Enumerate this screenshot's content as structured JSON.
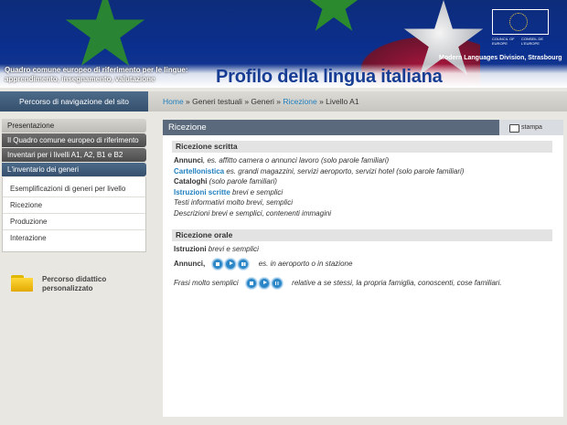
{
  "header": {
    "subtitle": "Quadro comune europeo di riferimento per le lingue: apprendimento, insegnamento, valutazione",
    "title": "Profilo della lingua italiana",
    "coe_left": "COUNCIL OF EUROPE",
    "coe_right": "CONSEIL DE L'EUROPE",
    "division": "Modern Languages Division, Strasbourg"
  },
  "nav": {
    "title": "Percorso di navigazione del sito",
    "breadcrumb": {
      "home": "Home",
      "sep": " » ",
      "c1": "Generi testuali",
      "c2": "Generi",
      "c3": "Ricezione",
      "c4": "Livello A1"
    }
  },
  "sidebar": {
    "items": [
      "Presentazione",
      "Il Quadro comune europeo di riferimento",
      "Inventari per i livelli A1, A2, B1 e B2",
      "L'inventario dei generi"
    ],
    "sub_items": [
      "Esemplificazioni di generi per livello",
      "Ricezione",
      "Produzione",
      "Interazione"
    ],
    "folder_label": "Percorso didattico personalizzato"
  },
  "main": {
    "title": "Ricezione",
    "print": "stampa",
    "scritta": {
      "heading": "Ricezione scritta",
      "rows": [
        {
          "bold": "Annunci",
          "rest": ", es. affitto camera o annunci lavoro (solo parole familiari)"
        },
        {
          "link": "Cartellonistica",
          "rest": " es. grandi magazzini, servizi aeroporto, servizi hotel (solo parole familiari)"
        },
        {
          "bold": "Cataloghi",
          "rest": " (solo parole familiari)"
        },
        {
          "link": "Istruzioni scritte",
          "rest": " brevi e semplici"
        },
        {
          "plain": "Testi informativi molto brevi, semplici"
        },
        {
          "plain": "Descrizioni brevi e semplici, contenenti immagini"
        }
      ]
    },
    "orale": {
      "heading": "Ricezione orale",
      "row1_bold": "Istruzioni",
      "row1_rest": " brevi e semplici",
      "row2_bold": "Annunci,",
      "row2_rest": "es. in aeroporto o in stazione",
      "row3_text": "Frasi molto semplici",
      "row3_rest": "relative a se stessi, la propria famiglia, conoscenti, cose familiari."
    }
  }
}
